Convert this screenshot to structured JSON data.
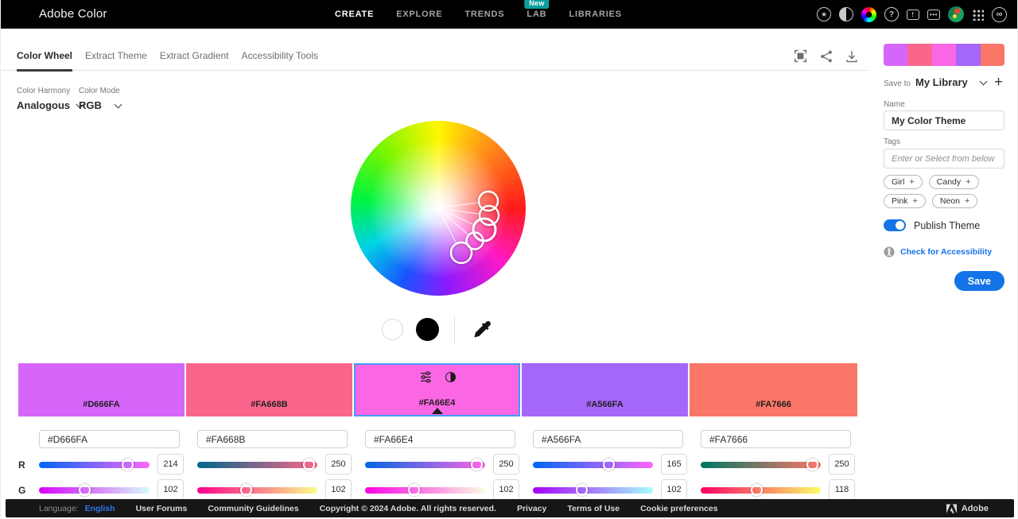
{
  "nav": {
    "brand": "Adobe Color",
    "items": [
      {
        "label": "CREATE",
        "active": true
      },
      {
        "label": "EXPLORE"
      },
      {
        "label": "TRENDS"
      },
      {
        "label": "LAB",
        "badge": "New"
      },
      {
        "label": "LIBRARIES"
      }
    ],
    "icons": [
      "star-circle-icon",
      "contrast-icon",
      "color-wheel-icon",
      "help-icon",
      "feedback-icon",
      "chat-icon",
      "avatar",
      "apps-grid-icon",
      "creative-cloud-icon"
    ]
  },
  "toolbar": {
    "tabs": [
      {
        "label": "Color Wheel",
        "active": true
      },
      {
        "label": "Extract Theme"
      },
      {
        "label": "Extract Gradient"
      },
      {
        "label": "Accessibility Tools"
      }
    ],
    "icons": [
      "fullscreen-icon",
      "share-icon",
      "download-icon"
    ]
  },
  "controls": {
    "harmony_label": "Color Harmony",
    "harmony_value": "Analogous",
    "mode_label": "Color Mode",
    "mode_value": "RGB"
  },
  "channel_labels": [
    "R",
    "G"
  ],
  "swatches": [
    {
      "hex": "#D666FA",
      "r": 214,
      "g": 102,
      "selected": false
    },
    {
      "hex": "#FA668B",
      "r": 250,
      "g": 102,
      "selected": false
    },
    {
      "hex": "#FA66E4",
      "r": 250,
      "g": 102,
      "selected": true
    },
    {
      "hex": "#A566FA",
      "r": 165,
      "g": 102,
      "selected": false
    },
    {
      "hex": "#FA7666",
      "r": 250,
      "g": 118,
      "selected": false
    }
  ],
  "sidebar": {
    "save_to_label": "Save to",
    "library_value": "My Library",
    "name_label": "Name",
    "name_value": "My Color Theme",
    "tags_label": "Tags",
    "tags_placeholder": "Enter or Select from below",
    "tag_suggestions": [
      "Girl",
      "Candy",
      "Pink",
      "Neon"
    ],
    "publish_label": "Publish Theme",
    "accessibility_link": "Check for Accessibility",
    "save_label": "Save"
  },
  "footer": {
    "language_label": "Language:",
    "language_value": "English",
    "links": [
      "User Forums",
      "Community Guidelines",
      "Copyright © 2024 Adobe. All rights reserved.",
      "Privacy",
      "Terms of Use",
      "Cookie preferences"
    ],
    "brand": "Adobe"
  },
  "colors": {
    "accent": "#1473E6",
    "selected_swatch_border": "#459AF5",
    "new_badge": "#0D9E9E"
  }
}
